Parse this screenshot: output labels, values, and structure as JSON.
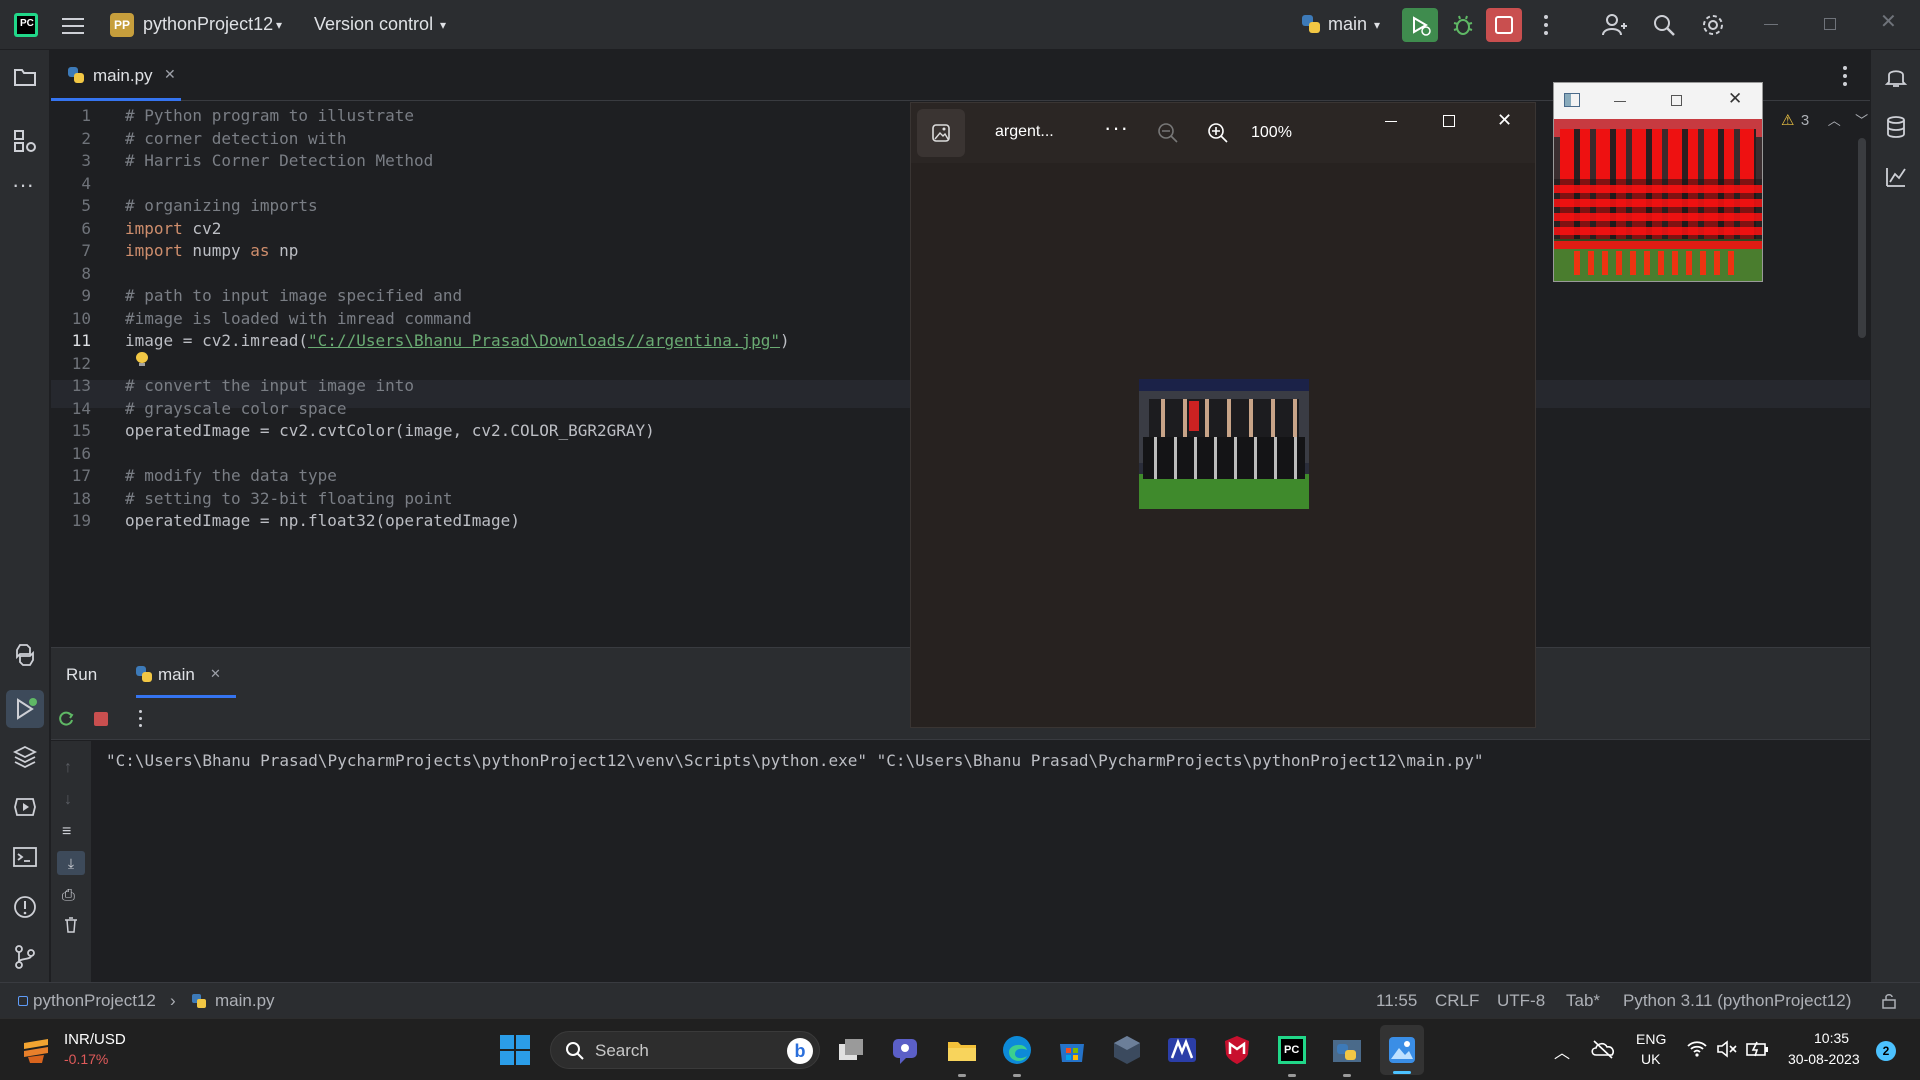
{
  "titlebar": {
    "project_badge": "PP",
    "project_name": "pythonProject12",
    "vcs_label": "Version control",
    "run_config": "main"
  },
  "editor": {
    "tab": "main.py",
    "warning_count": "3",
    "lines": [
      {
        "n": "1",
        "text": "# Python program to illustrate"
      },
      {
        "n": "2",
        "text": "# corner detection with"
      },
      {
        "n": "3",
        "text": "# Harris Corner Detection Method"
      },
      {
        "n": "4",
        "text": ""
      },
      {
        "n": "5",
        "text": "# organizing imports"
      },
      {
        "n": "6",
        "kw": "import",
        "rest": " cv2"
      },
      {
        "n": "7",
        "kw": "import",
        "rest": " numpy ",
        "kw2": "as",
        "rest2": " np"
      },
      {
        "n": "8",
        "text": ""
      },
      {
        "n": "9",
        "text": "# path to input image specified and"
      },
      {
        "n": "10",
        "text": "#image is loaded with imread command"
      },
      {
        "n": "11",
        "pre": "image = cv2.imread(",
        "str": "\"C://Users\\Bhanu Prasad\\Downloads//argentina.jpg\"",
        "post": ")"
      },
      {
        "n": "12",
        "text": ""
      },
      {
        "n": "13",
        "text": "# convert the input image into"
      },
      {
        "n": "14",
        "text": "# grayscale color space"
      },
      {
        "n": "15",
        "text": "operatedImage = cv2.cvtColor(image, cv2.COLOR_BGR2GRAY)"
      },
      {
        "n": "16",
        "text": ""
      },
      {
        "n": "17",
        "text": "# modify the data type"
      },
      {
        "n": "18",
        "text": "# setting to 32-bit floating point"
      },
      {
        "n": "19",
        "text": "operatedImage = np.float32(operatedImage)"
      }
    ]
  },
  "run": {
    "tab_run": "Run",
    "tab_main": "main",
    "output": "\"C:\\Users\\Bhanu Prasad\\PycharmProjects\\pythonProject12\\venv\\Scripts\\python.exe\" \"C:\\Users\\Bhanu Prasad\\PycharmProjects\\pythonProject12\\main.py\""
  },
  "photos": {
    "title": "argent...",
    "zoom": "100%"
  },
  "statusbar": {
    "project": "pythonProject12",
    "file": "main.py",
    "position": "11:55",
    "line_sep": "CRLF",
    "encoding": "UTF-8",
    "indent": "Tab*",
    "interpreter": "Python 3.11 (pythonProject12)"
  },
  "taskbar": {
    "ticker_name": "INR/USD",
    "ticker_change": "-0.17%",
    "search_placeholder": "Search",
    "lang_1": "ENG",
    "lang_2": "UK",
    "time": "10:35",
    "date": "30-08-2023",
    "notif_count": "2",
    "colors": {
      "ticker_negative": "#e05a5a",
      "windows_blue": "#0078d4"
    }
  }
}
